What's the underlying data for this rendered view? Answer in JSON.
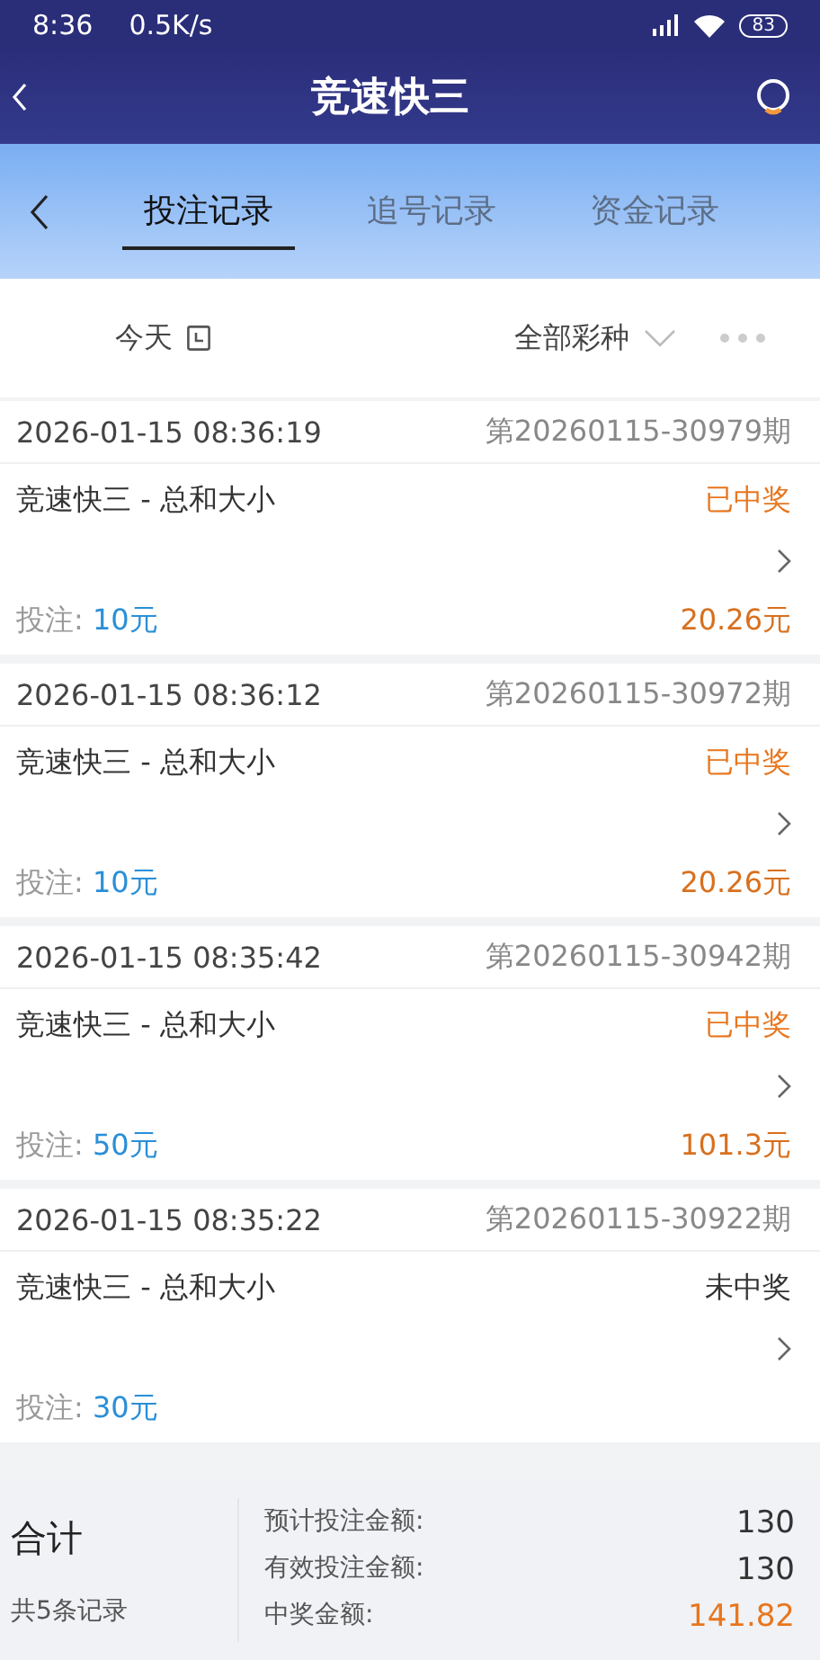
{
  "status_bar": {
    "time": "8:36",
    "speed": "0.5K/s",
    "battery": "83"
  },
  "header": {
    "title": "竞速快三"
  },
  "tabs": [
    {
      "label": "投注记录",
      "selected": true
    },
    {
      "label": "追号记录",
      "selected": false
    },
    {
      "label": "资金记录",
      "selected": false
    }
  ],
  "filter": {
    "date": "今天",
    "lottery": "全部彩种"
  },
  "records": [
    {
      "time": "2026-01-15 08:36:19",
      "issue": "第20260115-30979期",
      "name": "竞速快三 - 总和大小",
      "status": "已中奖",
      "won": true,
      "bet_label": "投注:",
      "bet": "10元",
      "payout": "20.26元"
    },
    {
      "time": "2026-01-15 08:36:12",
      "issue": "第20260115-30972期",
      "name": "竞速快三 - 总和大小",
      "status": "已中奖",
      "won": true,
      "bet_label": "投注:",
      "bet": "10元",
      "payout": "20.26元"
    },
    {
      "time": "2026-01-15 08:35:42",
      "issue": "第20260115-30942期",
      "name": "竞速快三 - 总和大小",
      "status": "已中奖",
      "won": true,
      "bet_label": "投注:",
      "bet": "50元",
      "payout": "101.3元"
    },
    {
      "time": "2026-01-15 08:35:22",
      "issue": "第20260115-30922期",
      "name": "竞速快三 - 总和大小",
      "status": "未中奖",
      "won": false,
      "bet_label": "投注:",
      "bet": "30元"
    }
  ],
  "summary": {
    "title": "合计",
    "count": "共5条记录",
    "lines": [
      {
        "label": "预计投注金额:",
        "value": "130",
        "highlight": false
      },
      {
        "label": "有效投注金额:",
        "value": "130",
        "highlight": false
      },
      {
        "label": "中奖金额:",
        "value": "141.82",
        "highlight": true
      }
    ]
  }
}
